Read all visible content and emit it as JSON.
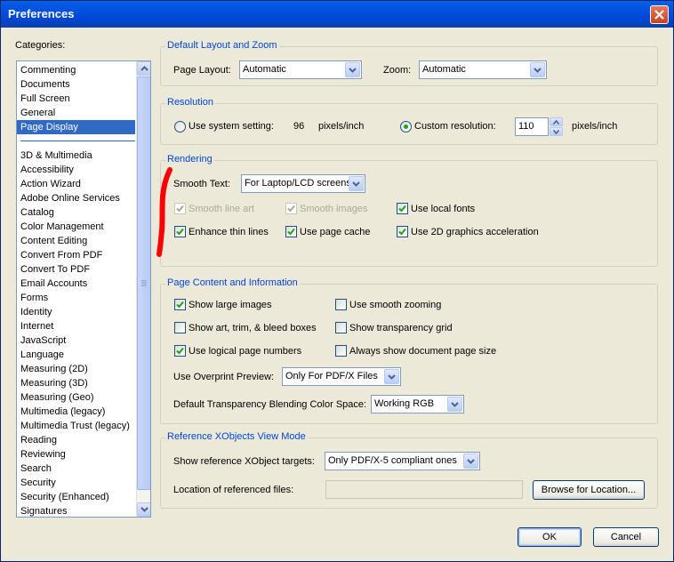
{
  "window": {
    "title": "Preferences"
  },
  "categories": {
    "label": "Categories:",
    "top_items": [
      "Commenting",
      "Documents",
      "Full Screen",
      "General",
      "Page Display"
    ],
    "selected": "Page Display",
    "items": [
      "3D & Multimedia",
      "Accessibility",
      "Action Wizard",
      "Adobe Online Services",
      "Catalog",
      "Color Management",
      "Content Editing",
      "Convert From PDF",
      "Convert To PDF",
      "Email Accounts",
      "Forms",
      "Identity",
      "Internet",
      "JavaScript",
      "Language",
      "Measuring (2D)",
      "Measuring (3D)",
      "Measuring (Geo)",
      "Multimedia (legacy)",
      "Multimedia Trust (legacy)",
      "Reading",
      "Reviewing",
      "Search",
      "Security",
      "Security (Enhanced)",
      "Signatures"
    ]
  },
  "layout_zoom": {
    "title": "Default Layout and Zoom",
    "page_layout_label": "Page Layout:",
    "page_layout_value": "Automatic",
    "zoom_label": "Zoom:",
    "zoom_value": "Automatic"
  },
  "resolution": {
    "title": "Resolution",
    "system_label": "Use system setting:",
    "system_value": "96",
    "system_unit": "pixels/inch",
    "system_selected": false,
    "custom_label": "Custom resolution:",
    "custom_value": "110",
    "custom_unit": "pixels/inch",
    "custom_selected": true
  },
  "rendering": {
    "title": "Rendering",
    "smooth_text_label": "Smooth Text:",
    "smooth_text_value": "For Laptop/LCD screens",
    "smooth_line_art": "Smooth line art",
    "smooth_images": "Smooth images",
    "use_local_fonts": "Use local fonts",
    "enhance_thin_lines": "Enhance thin lines",
    "use_page_cache": "Use page cache",
    "use_2d_accel": "Use 2D graphics acceleration"
  },
  "page_content": {
    "title": "Page Content and Information",
    "show_large_images": "Show large images",
    "use_smooth_zooming": "Use smooth zooming",
    "show_art_trim_bleed": "Show art, trim, & bleed boxes",
    "show_transparency_grid": "Show transparency grid",
    "use_logical_page_numbers": "Use logical page numbers",
    "always_show_doc_size": "Always show document page size",
    "overprint_label": "Use Overprint Preview:",
    "overprint_value": "Only For PDF/X Files",
    "blend_label": "Default Transparency Blending Color Space:",
    "blend_value": "Working RGB"
  },
  "xobjects": {
    "title": "Reference XObjects View Mode",
    "targets_label": "Show reference XObject targets:",
    "targets_value": "Only PDF/X-5 compliant ones",
    "location_label": "Location of referenced files:",
    "location_value": "",
    "browse_label": "Browse for Location..."
  },
  "buttons": {
    "ok": "OK",
    "cancel": "Cancel"
  },
  "colors": {
    "selection": "#316AC5",
    "group_title": "#0046D5",
    "annotation": "#FF0000",
    "dialog_bg": "#ECE9D8"
  }
}
